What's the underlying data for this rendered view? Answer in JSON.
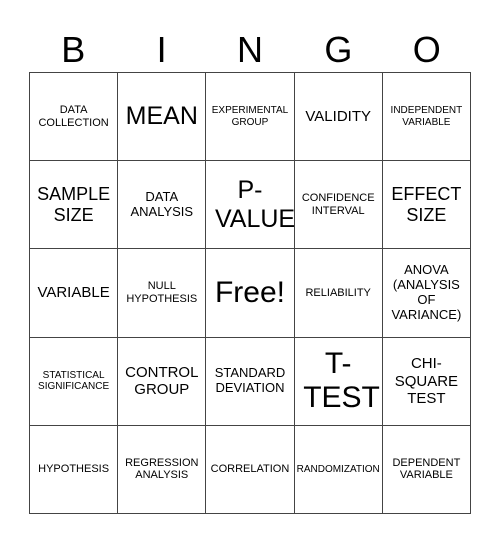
{
  "header": [
    "B",
    "I",
    "N",
    "G",
    "O"
  ],
  "cells": [
    [
      "DATA COLLECTION",
      "MEAN",
      "EXPERIMENTAL GROUP",
      "VALIDITY",
      "INDEPENDENT VARIABLE"
    ],
    [
      "SAMPLE SIZE",
      "DATA ANALYSIS",
      "P-VALUE",
      "CONFIDENCE INTERVAL",
      "EFFECT SIZE"
    ],
    [
      "VARIABLE",
      "NULL HYPOTHESIS",
      "Free!",
      "RELIABILITY",
      "ANOVA (ANALYSIS OF VARIANCE)"
    ],
    [
      "STATISTICAL SIGNIFICANCE",
      "CONTROL GROUP",
      "STANDARD DEVIATION",
      "T-TEST",
      "CHI-SQUARE TEST"
    ],
    [
      "HYPOTHESIS",
      "REGRESSION ANALYSIS",
      "CORRELATION",
      "RANDOMIZATION",
      "DEPENDENT VARIABLE"
    ]
  ]
}
